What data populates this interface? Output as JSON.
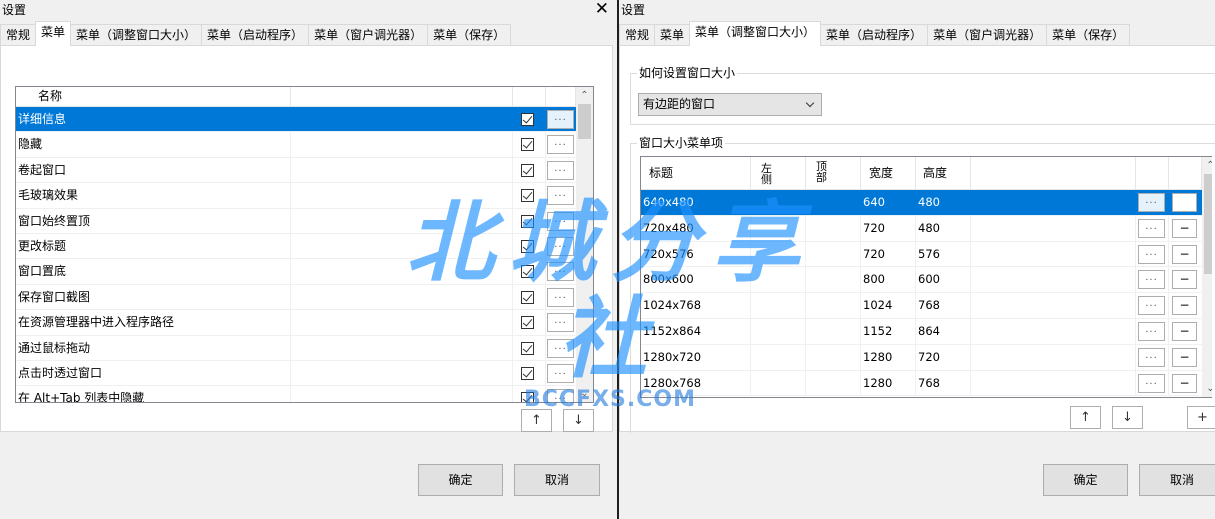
{
  "left_window": {
    "title": "设置",
    "close_glyph": "✕",
    "tabs": [
      {
        "label": "常规"
      },
      {
        "label": "菜单"
      },
      {
        "label": "菜单（调整窗口大小）"
      },
      {
        "label": "菜单（启动程序）"
      },
      {
        "label": "菜单（窗户调光器）"
      },
      {
        "label": "菜单（保存）"
      }
    ],
    "active_tab": 1,
    "list": {
      "header": "名称",
      "selected_index": 0,
      "button_label": "...",
      "rows": [
        {
          "name": "详细信息"
        },
        {
          "name": "隐藏"
        },
        {
          "name": "卷起窗口"
        },
        {
          "name": "毛玻璃效果"
        },
        {
          "name": "窗口始终置顶"
        },
        {
          "name": "更改标题"
        },
        {
          "name": "窗口置底"
        },
        {
          "name": "保存窗口截图"
        },
        {
          "name": "在资源管理器中进入程序路径"
        },
        {
          "name": "通过鼠标拖动"
        },
        {
          "name": "点击时透过窗口"
        },
        {
          "name": "在 Alt+Tab 列表中隐藏"
        }
      ]
    },
    "up_arrow": "↑",
    "down_arrow": "↓",
    "ok_label": "确定",
    "cancel_label": "取消"
  },
  "right_window": {
    "title": "设置",
    "tabs": [
      {
        "label": "常规"
      },
      {
        "label": "菜单"
      },
      {
        "label": "菜单（调整窗口大小）"
      },
      {
        "label": "菜单（启动程序）"
      },
      {
        "label": "菜单（窗户调光器）"
      },
      {
        "label": "菜单（保存）"
      }
    ],
    "active_tab": 2,
    "group1_label": "如何设置窗口大小",
    "combo_value": "有边距的窗口",
    "group2_label": "窗口大小菜单项",
    "table": {
      "headers": {
        "title": "标题",
        "left": "左侧",
        "top": "顶部",
        "width": "宽度",
        "height": "高度"
      },
      "selected_index": 0,
      "button_label": "...",
      "minus_label": "−",
      "rows": [
        {
          "title": "640x480",
          "left": "",
          "top": "",
          "width": "640",
          "height": "480"
        },
        {
          "title": "720x480",
          "left": "",
          "top": "",
          "width": "720",
          "height": "480"
        },
        {
          "title": "720x576",
          "left": "",
          "top": "",
          "width": "720",
          "height": "576"
        },
        {
          "title": "800x600",
          "left": "",
          "top": "",
          "width": "800",
          "height": "600"
        },
        {
          "title": "1024x768",
          "left": "",
          "top": "",
          "width": "1024",
          "height": "768"
        },
        {
          "title": "1152x864",
          "left": "",
          "top": "",
          "width": "1152",
          "height": "864"
        },
        {
          "title": "1280x720",
          "left": "",
          "top": "",
          "width": "1280",
          "height": "720"
        },
        {
          "title": "1280x768",
          "left": "",
          "top": "",
          "width": "1280",
          "height": "768"
        }
      ]
    },
    "up_arrow": "↑",
    "down_arrow": "↓",
    "plus_label": "+",
    "ok_label": "确定",
    "cancel_label": "取消"
  },
  "watermark": {
    "big": "北城分享社",
    "small": "BCCFXS.COM"
  },
  "colors": {
    "selection": "#0078d7",
    "watermark": "#1e90ff"
  }
}
